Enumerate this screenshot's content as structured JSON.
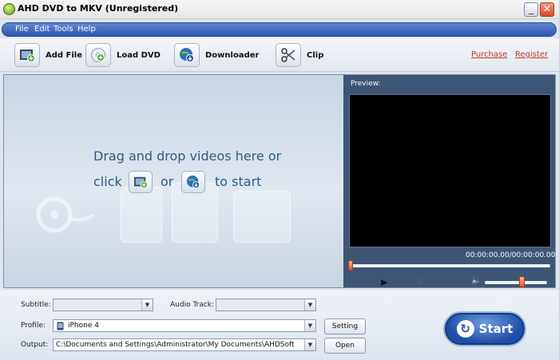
{
  "window": {
    "title": "AHD DVD to MKV (Unregistered)",
    "minimize": "_",
    "close": "✕"
  },
  "menu": {
    "items": [
      "File",
      "Edit",
      "Tools",
      "Help"
    ]
  },
  "toolbar": {
    "add_file": "Add File",
    "load_dvd": "Load DVD",
    "downloader": "Downloader",
    "clip": "Clip",
    "purchase": "Purchase",
    "register": "Register"
  },
  "drop": {
    "line1": "Drag and drop videos here or",
    "click": "click",
    "or": "or",
    "to_start": "to start"
  },
  "preview": {
    "label": "Preview:",
    "time": "00:00:00.00/00:00:00.00",
    "seek_position": 0.0,
    "volume_level": 0.55
  },
  "controls": {
    "play_glyph": "▶",
    "stop_glyph": "■",
    "volume_glyph": "🔈"
  },
  "settings": {
    "subtitle_label": "Subtitle:",
    "subtitle_value": "",
    "audio_label": "Audio Track:",
    "audio_value": "",
    "profile_label": "Profile:",
    "profile_value": "iPhone 4",
    "output_label": "Output:",
    "output_value": "C:\\Documents and Settings\\Administrator\\My Documents\\AHDSoft",
    "setting_button": "Setting",
    "open_button": "Open",
    "start_button": "Start",
    "start_glyph": "↻",
    "arrow_glyph": "▼"
  },
  "colors": {
    "accent": "#2f58b1",
    "link": "#c0392b",
    "preview_bg": "#000000"
  }
}
